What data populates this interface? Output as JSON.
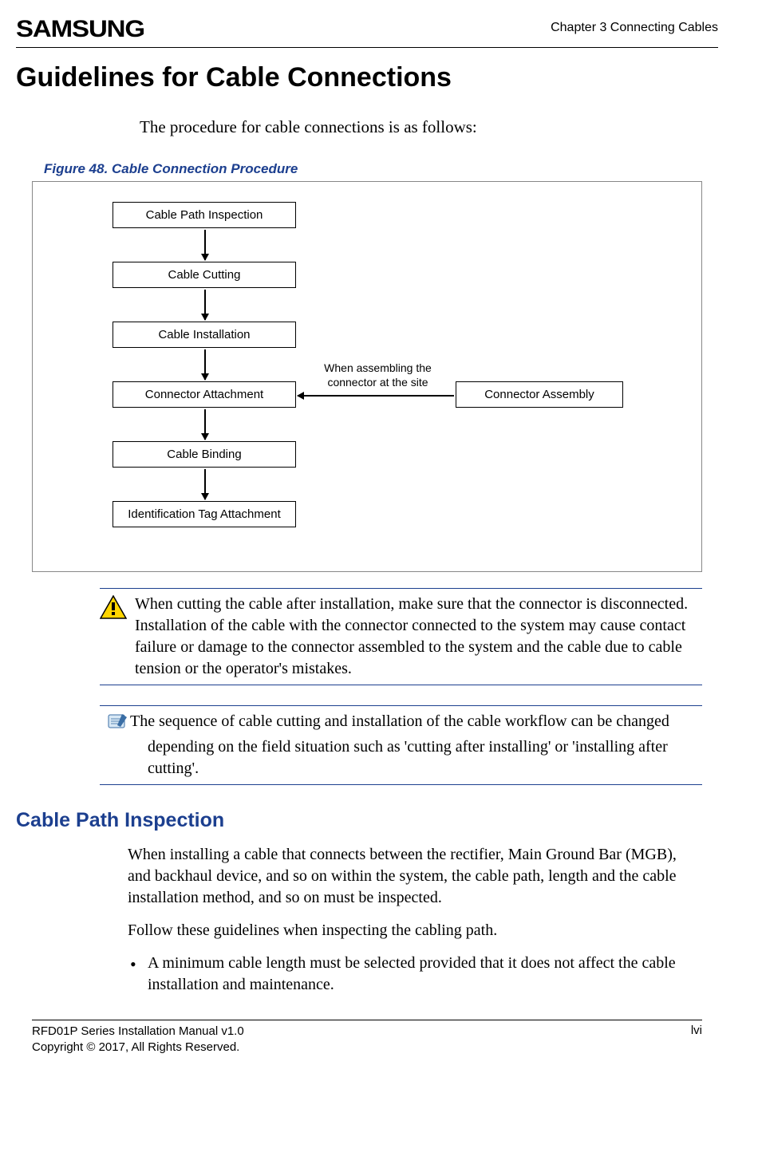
{
  "header": {
    "logo": "SAMSUNG",
    "chapter": "Chapter 3 Connecting Cables"
  },
  "title": "Guidelines for Cable Connections",
  "intro": "The procedure for cable connections is as follows:",
  "figure": {
    "caption": "Figure 48. Cable Connection Procedure",
    "nodes": {
      "n1": "Cable Path Inspection",
      "n2": "Cable Cutting",
      "n3": "Cable Installation",
      "n4": "Connector Attachment",
      "n5": "Cable Binding",
      "n6": "Identification Tag Attachment",
      "side": "Connector Assembly"
    },
    "side_label_l1": "When assembling the",
    "side_label_l2": "connector at the site"
  },
  "warning": "When cutting the cable after installation, make sure that the connector is disconnected. Installation of the cable with the connector connected to the system may cause contact failure or damage to the connector assembled to the system and the cable due to cable tension or the operator's mistakes.",
  "note": "The sequence of cable cutting and installation of the cable workflow can be changed depending on the field situation such as 'cutting after installing' or 'installing after cutting'.",
  "section": {
    "heading": "Cable Path Inspection",
    "p1": "When installing a cable that connects between the rectifier, Main Ground Bar (MGB), and backhaul device, and so on within the system, the cable path, length and the cable installation method, and so on must be inspected.",
    "p2": "Follow these guidelines when inspecting the cabling path.",
    "bullet1": "A minimum cable length must be selected provided that it does not affect the cable installation and maintenance."
  },
  "footer": {
    "line1": "RFD01P Series Installation Manual   v1.0",
    "line2": "Copyright © 2017, All Rights Reserved.",
    "page": "lvi"
  },
  "icons": {
    "warning": "warning-triangle-icon",
    "note": "note-pad-icon"
  }
}
